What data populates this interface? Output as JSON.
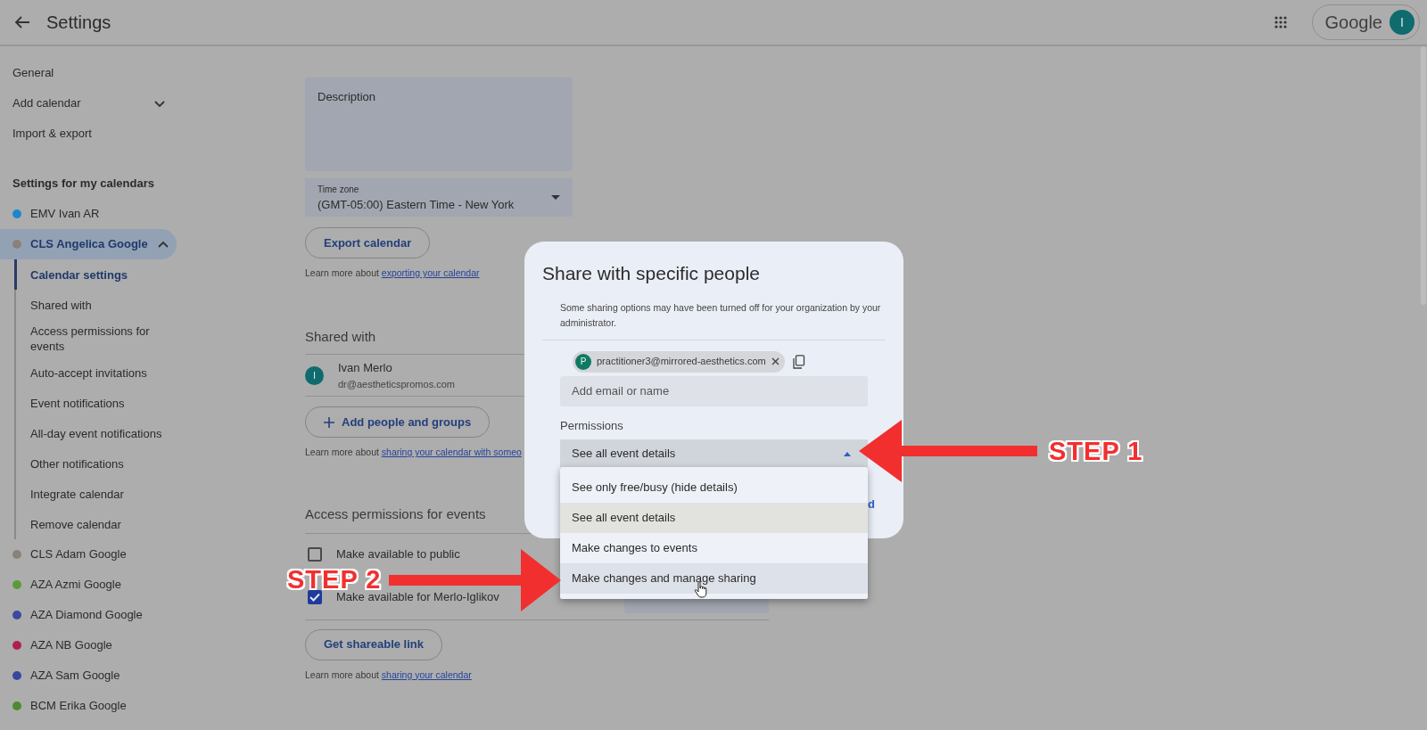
{
  "header": {
    "title": "Settings",
    "account_label": "Google",
    "avatar_initial": "I"
  },
  "sidebar": {
    "items": [
      {
        "label": "General"
      },
      {
        "label": "Add calendar",
        "expanded": false
      },
      {
        "label": "Import & export"
      }
    ],
    "section_title": "Settings for my calendars",
    "calendars": [
      {
        "name": "EMV Ivan AR",
        "color": "#1f86cc",
        "selected": false
      },
      {
        "name": "CLS Angelica Google",
        "color": "#8a8178",
        "selected": true,
        "expanded": true,
        "children": [
          {
            "label": "Calendar settings",
            "selected": true
          },
          {
            "label": "Shared with",
            "selected": false
          },
          {
            "label": "Access permissions for events",
            "selected": false
          },
          {
            "label": "Auto-accept invitations",
            "selected": false
          },
          {
            "label": "Event notifications",
            "selected": false
          },
          {
            "label": "All-day event notifications",
            "selected": false
          },
          {
            "label": "Other notifications",
            "selected": false
          },
          {
            "label": "Integrate calendar",
            "selected": false
          },
          {
            "label": "Remove calendar",
            "selected": false
          }
        ]
      },
      {
        "name": "CLS Adam Google",
        "color": "#8a8178",
        "selected": false
      },
      {
        "name": "AZA Azmi Google",
        "color": "#5c9a3a",
        "selected": false
      },
      {
        "name": "AZA Diamond Google",
        "color": "#3a4aa0",
        "selected": false
      },
      {
        "name": "AZA NB Google",
        "color": "#b0204c",
        "selected": false
      },
      {
        "name": "AZA Sam Google",
        "color": "#3548a0",
        "selected": false
      },
      {
        "name": "BCM Erika Google",
        "color": "#4e8a30",
        "selected": false
      }
    ]
  },
  "main": {
    "description_field": {
      "label": "Description"
    },
    "time_zone": {
      "label": "Time zone",
      "value": "(GMT-05:00) Eastern Time - New York"
    },
    "export_button": "Export calendar",
    "export_note": {
      "text": "Learn more about",
      "link": "exporting your calendar"
    },
    "shared_with": {
      "title": "Shared with",
      "people": [
        {
          "initial": "I",
          "name": "Ivan Merlo",
          "email": "dr@aestheticspromos.com"
        }
      ],
      "add_button": "Add people and groups",
      "note": {
        "text": "Learn more about",
        "link": "sharing your calendar with someo"
      }
    },
    "access_permissions": {
      "title": "Access permissions for events",
      "options": [
        {
          "label": "Make available to public",
          "checked": false
        },
        {
          "label": "Make available for Merlo-Iglikov",
          "checked": true
        }
      ],
      "link_button": "Get shareable link",
      "note": {
        "text": "Learn more about",
        "link": "sharing your calendar"
      }
    }
  },
  "dialog": {
    "title": "Share with specific people",
    "notice": "Some sharing options may have been turned off for your organization by your administrator.",
    "recipients": [
      {
        "initial": "P",
        "email": "practitioner3@mirrored-aesthetics.com"
      }
    ],
    "input": {
      "placeholder": "Add email or name"
    },
    "permissions": {
      "label": "Permissions",
      "value": "See all event details",
      "expanded": true,
      "options": [
        {
          "label": "See only free/busy (hide details)",
          "selected": false,
          "hovered": false
        },
        {
          "label": "See all event details",
          "selected": true,
          "hovered": false
        },
        {
          "label": "Make changes to events",
          "selected": false,
          "hovered": false
        },
        {
          "label": "Make changes and manage sharing",
          "selected": false,
          "hovered": true
        }
      ]
    },
    "footer_fragment": "d"
  },
  "annotations": [
    {
      "kind": "arrow-left",
      "label": "STEP 1"
    },
    {
      "kind": "arrow-right",
      "label": "STEP 2"
    }
  ]
}
